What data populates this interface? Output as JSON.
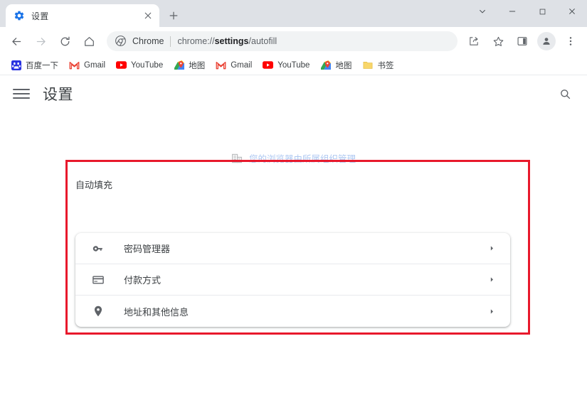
{
  "window": {
    "controls": {
      "tab_search": "tab-search-chevron",
      "minimize": "minimize",
      "maximize": "maximize",
      "close": "close"
    }
  },
  "tabstrip": {
    "tabs": [
      {
        "title": "设置",
        "favicon": "gear-icon",
        "close_label": "×",
        "active": true
      }
    ],
    "new_tab_label": "+"
  },
  "toolbar": {
    "back_label": "←",
    "forward_label": "→",
    "reload_label": "⟳",
    "home_label": "⌂",
    "omnibox": {
      "site_label": "Chrome",
      "url_prefix": "chrome://",
      "url_bold": "settings",
      "url_suffix": "/autofill",
      "full_url": "chrome://settings/autofill",
      "icon": "chrome-logo-icon"
    },
    "share_label": "share-icon",
    "bookmark_star_label": "star-icon",
    "side_panel_label": "side-panel-icon",
    "profile_label": "profile-avatar-icon",
    "menu_label": "three-dot-menu-icon"
  },
  "bookmarks": {
    "items": [
      {
        "label": "百度一下",
        "icon": "baidu-icon"
      },
      {
        "label": "Gmail",
        "icon": "gmail-icon"
      },
      {
        "label": "YouTube",
        "icon": "youtube-icon"
      },
      {
        "label": "地图",
        "icon": "maps-icon"
      },
      {
        "label": "Gmail",
        "icon": "gmail-icon"
      },
      {
        "label": "YouTube",
        "icon": "youtube-icon"
      },
      {
        "label": "地图",
        "icon": "maps-icon"
      },
      {
        "label": "书签",
        "icon": "folder-icon"
      }
    ]
  },
  "settings": {
    "menu_label": "hamburger-menu-icon",
    "title": "设置",
    "search_label": "search-icon",
    "managed_notice": {
      "text": "您的浏览器由所属组织管理",
      "icon": "building-icon"
    },
    "autofill": {
      "section_title": "自动填充",
      "rows": [
        {
          "label": "密码管理器",
          "icon": "key-icon",
          "arrow": "chevron-right-icon"
        },
        {
          "label": "付款方式",
          "icon": "credit-card-icon",
          "arrow": "chevron-right-icon"
        },
        {
          "label": "地址和其他信息",
          "icon": "location-pin-icon",
          "arrow": "chevron-right-icon"
        }
      ]
    }
  },
  "annotation": {
    "highlight_color": "#e8192c"
  }
}
